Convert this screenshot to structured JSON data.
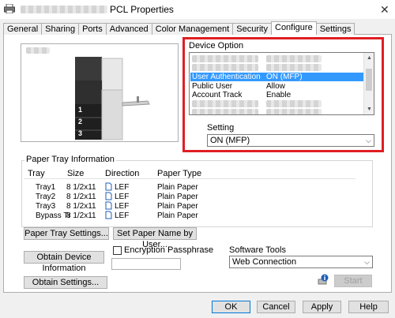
{
  "window": {
    "title": "PCL Properties",
    "close_glyph": "✕"
  },
  "tabs": [
    "General",
    "Sharing",
    "Ports",
    "Advanced",
    "Color Management",
    "Security",
    "Configure",
    "Settings"
  ],
  "active_tab": "Configure",
  "device_option": {
    "label": "Device Option",
    "rows": [
      {
        "name": "",
        "value": "",
        "blurred": true
      },
      {
        "name": "",
        "value": "",
        "blurred": true
      },
      {
        "name": "User Authentication",
        "value": "ON (MFP)",
        "selected": true
      },
      {
        "name": "Public User",
        "value": "Allow"
      },
      {
        "name": "Account Track",
        "value": "Enable"
      },
      {
        "name": "",
        "value": "",
        "blurred": true
      },
      {
        "name": "",
        "value": "",
        "blurred": true
      }
    ]
  },
  "setting": {
    "label": "Setting",
    "value": "ON (MFP)"
  },
  "paper_tray": {
    "label": "Paper Tray Information",
    "headers": [
      "Tray",
      "Size",
      "Direction",
      "Paper Type"
    ],
    "rows": [
      {
        "tray": "Tray1",
        "size": "8 1/2x11",
        "direction": "LEF",
        "type": "Plain Paper"
      },
      {
        "tray": "Tray2",
        "size": "8 1/2x11",
        "direction": "LEF",
        "type": "Plain Paper"
      },
      {
        "tray": "Tray3",
        "size": "8 1/2x11",
        "direction": "LEF",
        "type": "Plain Paper"
      },
      {
        "tray": "Bypass Tr",
        "size": "8 1/2x11",
        "direction": "LEF",
        "type": "Plain Paper"
      }
    ]
  },
  "printer_tray_numbers": [
    "1",
    "2",
    "3"
  ],
  "buttons": {
    "paper_tray_settings": "Paper Tray Settings...",
    "set_paper_name": "Set Paper Name by User...",
    "obtain_device_info": "Obtain Device Information",
    "obtain_settings": "Obtain Settings...",
    "start": "Start",
    "ok": "OK",
    "cancel": "Cancel",
    "apply": "Apply",
    "help": "Help"
  },
  "encryption": {
    "label": "Encryption Passphrase",
    "checked": false,
    "value": ""
  },
  "software_tools": {
    "label": "Software Tools",
    "value": "Web Connection"
  },
  "colors": {
    "selection": "#3399ff",
    "highlight_border": "#e01e23"
  }
}
